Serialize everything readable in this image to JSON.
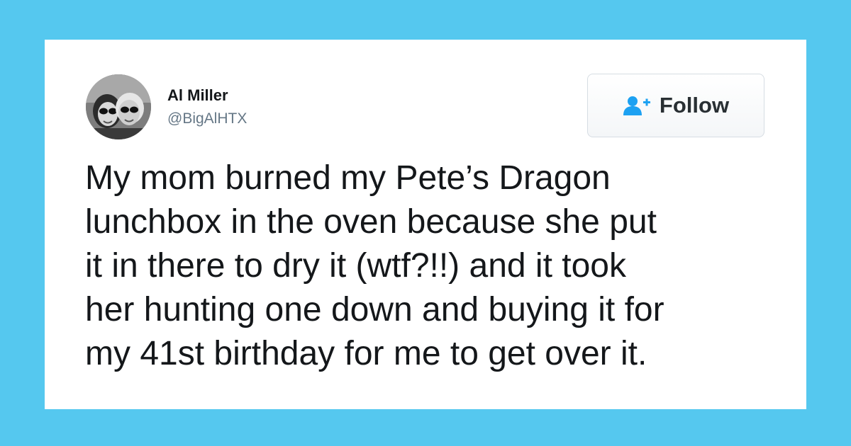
{
  "colors": {
    "background": "#55c8ef",
    "card": "#ffffff",
    "text": "#14171a",
    "handle": "#657786",
    "follow_icon": "#1da1f2",
    "follow_text": "#292f33"
  },
  "tweet": {
    "author": {
      "name": "Al Miller",
      "handle": "@BigAlHTX",
      "avatar_icon": "profile-photo"
    },
    "follow_button": {
      "label": "Follow",
      "icon": "add-user-icon"
    },
    "text_lines": [
      "My mom burned my Pete’s Dragon",
      "lunchbox in the oven because she put",
      "it in there to dry it (wtf?!!) and it took",
      "her hunting one down and buying it for",
      "my 41st birthday for me to get over it."
    ]
  }
}
